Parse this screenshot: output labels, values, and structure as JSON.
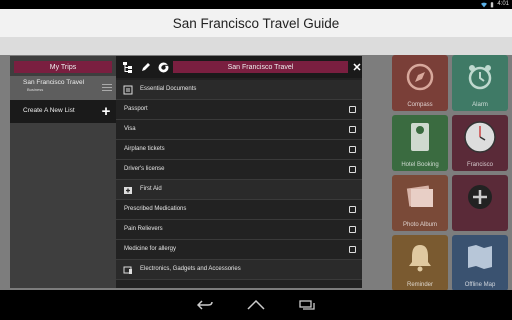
{
  "status_bar": {
    "time": "4:01"
  },
  "app": {
    "title": "San Francisco Travel Guide"
  },
  "background_tiles": [
    {
      "label": "Compass",
      "color": "#b23a2a"
    },
    {
      "label": "Alarm",
      "color": "#3aa07a"
    },
    {
      "label": "Hotel Booking",
      "color": "#3e9e4a"
    },
    {
      "label": "Francisco",
      "color": "#7a1f40"
    },
    {
      "label": "Photo Album",
      "color": "#c0532e"
    },
    {
      "label": "",
      "color": "#7a1f40"
    },
    {
      "label": "Reminder",
      "color": "#c58a2a"
    },
    {
      "label": "Offline Map",
      "color": "#2d5e9a"
    }
  ],
  "my_trips": {
    "header": "My Trips",
    "trip": {
      "name": "San Francisco Travel",
      "subtitle": "Business"
    },
    "create_label": "Create A New List"
  },
  "checklist": {
    "title": "San Francisco Travel",
    "toolbar_icons": [
      "tree-icon",
      "edit-icon",
      "chrome-icon"
    ],
    "rows": [
      {
        "type": "category",
        "label": "Essential Documents",
        "icon": "document-icon"
      },
      {
        "type": "item",
        "label": "Passport",
        "checked": false
      },
      {
        "type": "item",
        "label": "Visa",
        "checked": false
      },
      {
        "type": "item",
        "label": "Airplane tickets",
        "checked": false
      },
      {
        "type": "item",
        "label": "Driver's license",
        "checked": false
      },
      {
        "type": "category",
        "label": "First Aid",
        "icon": "first-aid-icon"
      },
      {
        "type": "item",
        "label": "Prescribed Medications",
        "checked": false
      },
      {
        "type": "item",
        "label": "Pain Relievers",
        "checked": false
      },
      {
        "type": "item",
        "label": "Medicine for allergy",
        "checked": false
      },
      {
        "type": "category",
        "label": "Electronics, Gadgets and Accessories",
        "icon": "device-icon"
      }
    ]
  },
  "colors": {
    "accent": "#7a1f40",
    "titlebar": "#f2f2f2"
  }
}
